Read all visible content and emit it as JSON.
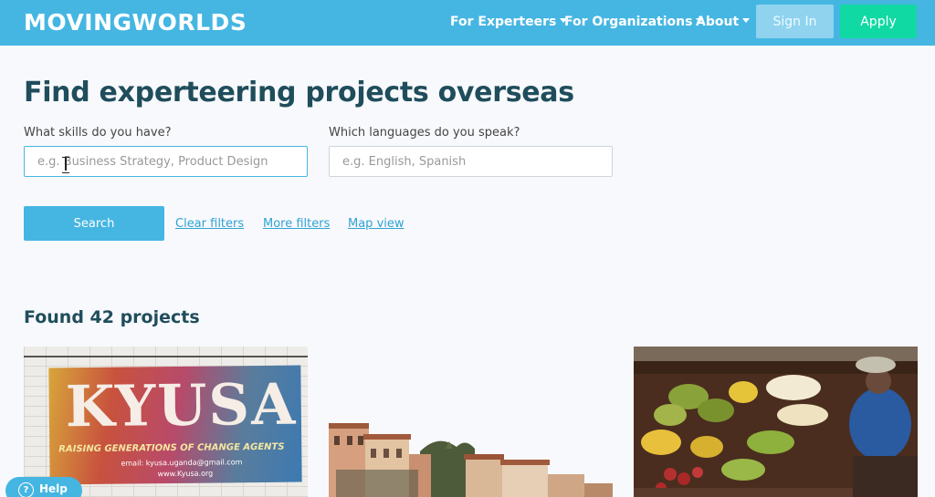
{
  "header": {
    "logo": "MOVINGWORLDS",
    "nav": [
      {
        "label": "For Experteers"
      },
      {
        "label": "For Organizations"
      },
      {
        "label": "About"
      }
    ],
    "signin_label": "Sign In",
    "apply_label": "Apply"
  },
  "search": {
    "title": "Find experteering projects overseas",
    "skills_label": "What skills do you have?",
    "skills_placeholder": "e.g. Business Strategy, Product Design",
    "languages_label": "Which languages do you speak?",
    "languages_placeholder": "e.g. English, Spanish",
    "search_label": "Search",
    "clear_label": "Clear filters",
    "more_label": "More filters",
    "map_label": "Map view"
  },
  "results": {
    "found_label": "Found 42 projects",
    "cards": [
      {
        "banner_word": "KYUSA",
        "banner_subtitle": "RAISING GENERATIONS OF CHANGE AGENTS",
        "banner_email": "email: kyusa.uganda@gmail.com",
        "banner_web": "www.Kyusa.org"
      },
      {},
      {}
    ]
  },
  "help": {
    "label": "Help"
  },
  "colors": {
    "brand": "#45b6e2",
    "apply": "#11d9a3",
    "heading": "#1f4d5c",
    "link": "#2fa3d3"
  }
}
